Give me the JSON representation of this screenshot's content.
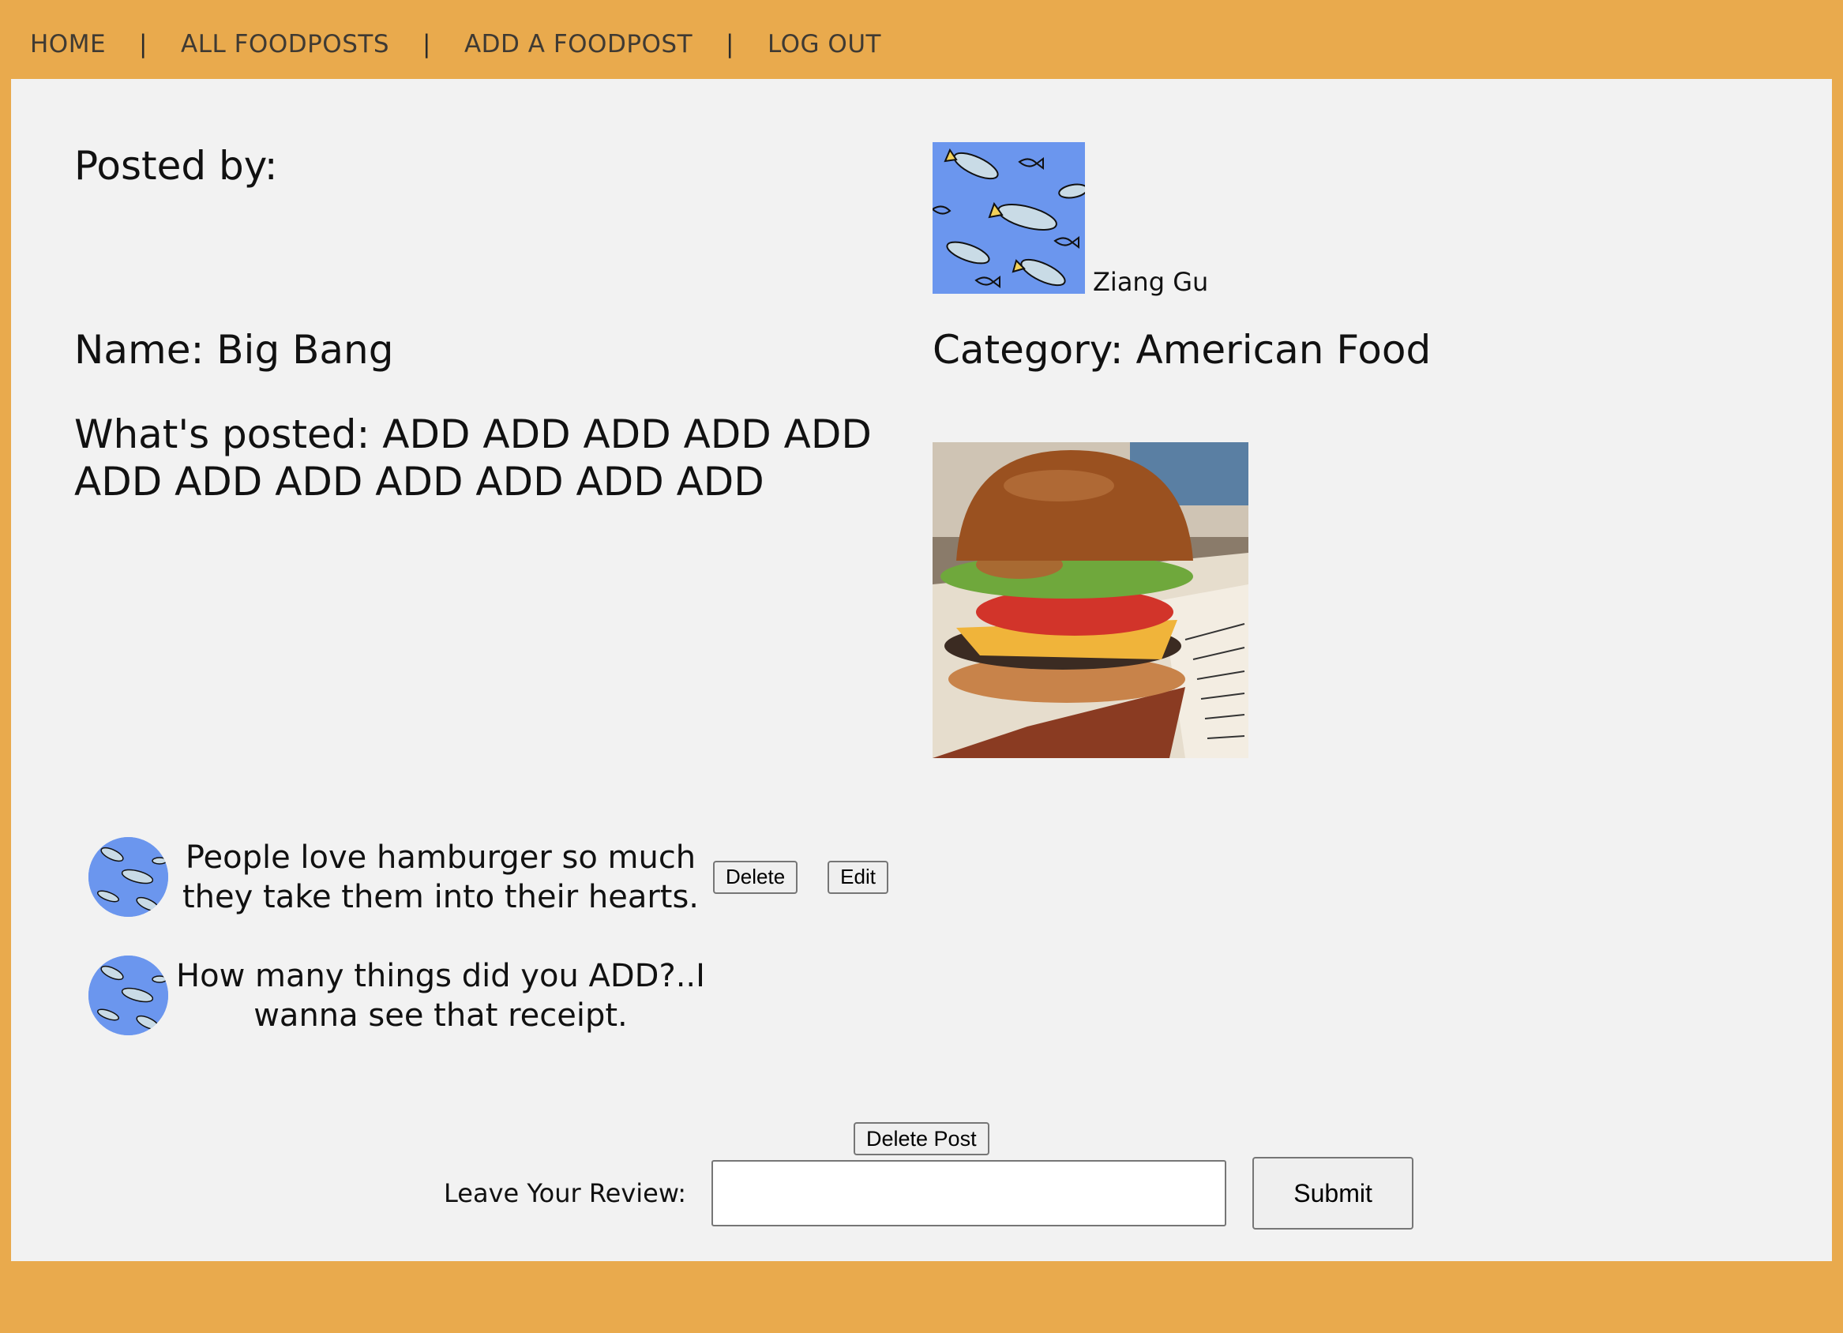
{
  "nav": {
    "items": [
      {
        "label": "HOME"
      },
      {
        "label": "ALL FOODPOSTS"
      },
      {
        "label": "ADD A FOODPOST"
      },
      {
        "label": "LOG OUT"
      }
    ],
    "separator": "|"
  },
  "post": {
    "posted_by_label": "Posted by:",
    "author_name": "Ziang Gu",
    "name_text": "Name: Big Bang",
    "category_text": "Category: American Food",
    "whats_posted_text": "What's posted: ADD ADD ADD ADD ADD ADD ADD ADD ADD ADD ADD ADD",
    "delete_post_label": "Delete Post"
  },
  "comments": [
    {
      "text": "People love hamburger so much they take them into their hearts.",
      "delete_label": "Delete",
      "edit_label": "Edit"
    },
    {
      "text": "How many things did you ADD?..I wanna see that receipt."
    }
  ],
  "review": {
    "label": "Leave Your Review:",
    "value": "",
    "submit_label": "Submit"
  },
  "colors": {
    "page_background": "#e9aa4d",
    "panel_background": "#f2f2f2",
    "avatar_blue": "#6b96ee"
  }
}
